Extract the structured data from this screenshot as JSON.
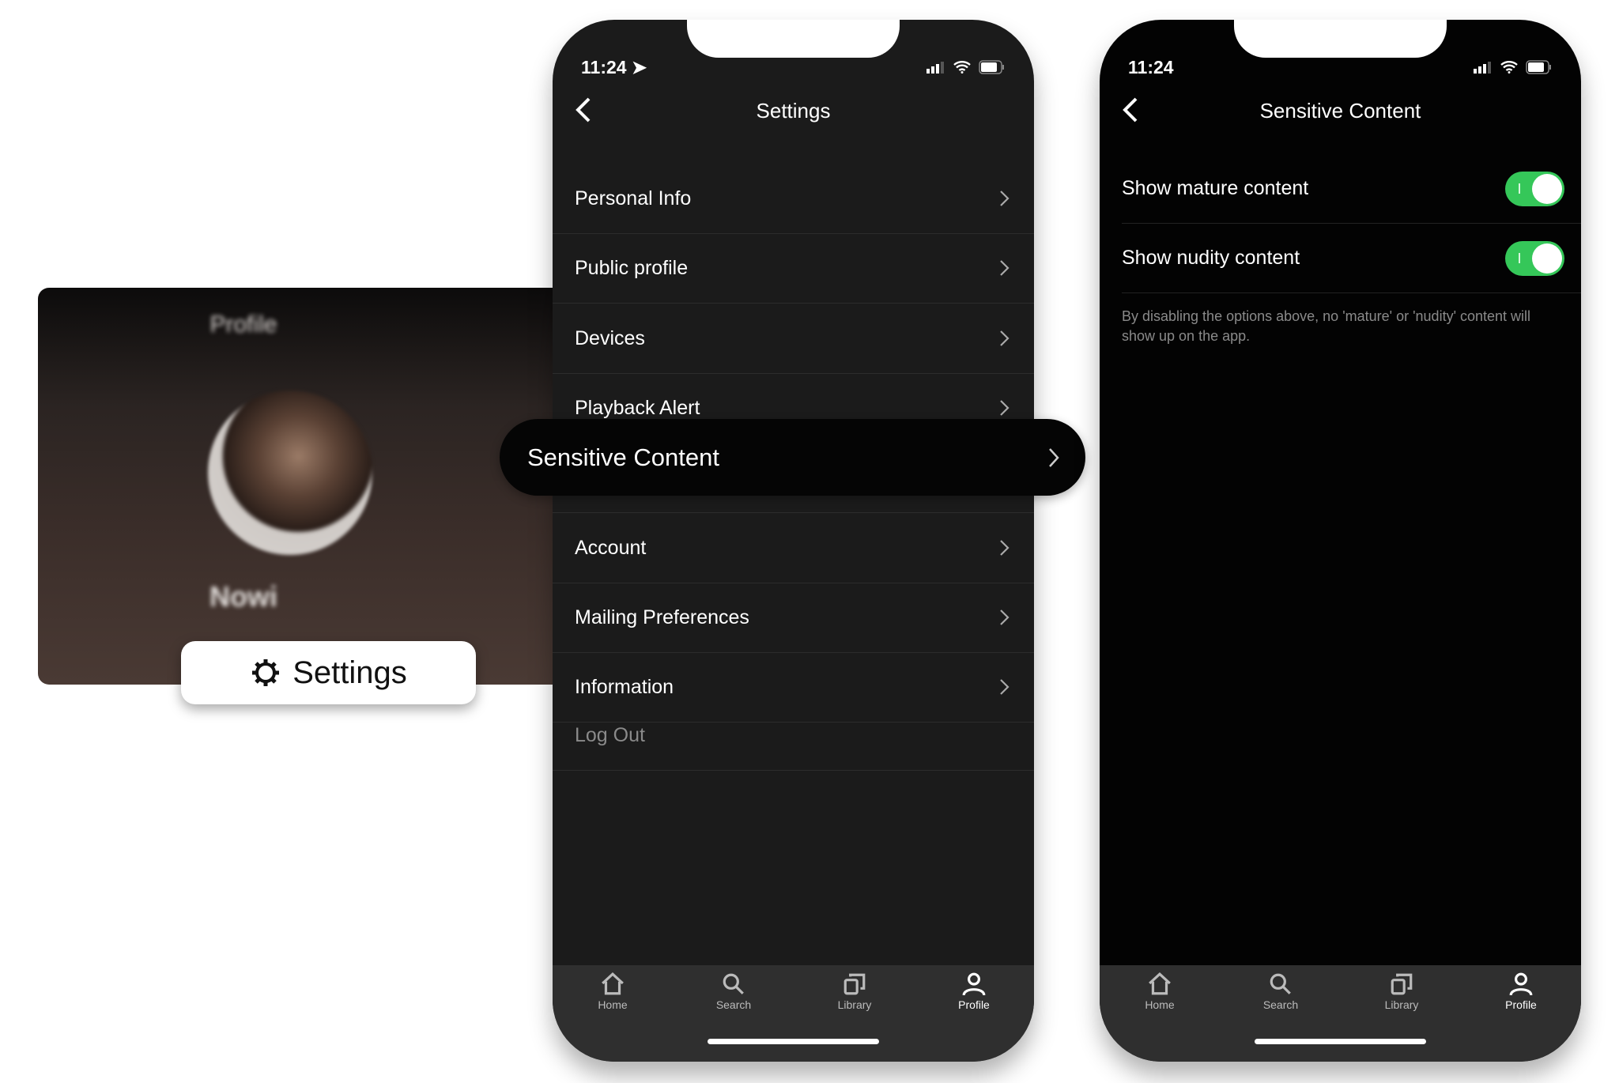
{
  "profile_card": {
    "title": "Profile",
    "name": "Nowi",
    "settings_button": "Settings"
  },
  "settings_screen": {
    "status_time": "11:24",
    "title": "Settings",
    "items": [
      {
        "label": "Personal Info"
      },
      {
        "label": "Public profile"
      },
      {
        "label": "Devices"
      },
      {
        "label": "Playback Alert"
      },
      {
        "label": "Sensitive Content"
      },
      {
        "label": "Account"
      },
      {
        "label": "Mailing Preferences"
      },
      {
        "label": "Information"
      }
    ],
    "logout": "Log Out",
    "highlighted_item": "Sensitive Content"
  },
  "sensitive_screen": {
    "status_time": "11:24",
    "title": "Sensitive Content",
    "options": [
      {
        "label": "Show mature content",
        "enabled": true
      },
      {
        "label": "Show nudity content",
        "enabled": true
      }
    ],
    "description": "By disabling the options above, no 'mature' or 'nudity' content will show up on the app."
  },
  "tabbar": {
    "items": [
      {
        "label": "Home",
        "icon": "home-icon"
      },
      {
        "label": "Search",
        "icon": "search-icon"
      },
      {
        "label": "Library",
        "icon": "library-icon"
      },
      {
        "label": "Profile",
        "icon": "profile-icon"
      }
    ],
    "active": "Profile"
  },
  "colors": {
    "toggle_on": "#35c759",
    "background": "#1b1b1b",
    "tabbar": "#2f2f2f"
  }
}
